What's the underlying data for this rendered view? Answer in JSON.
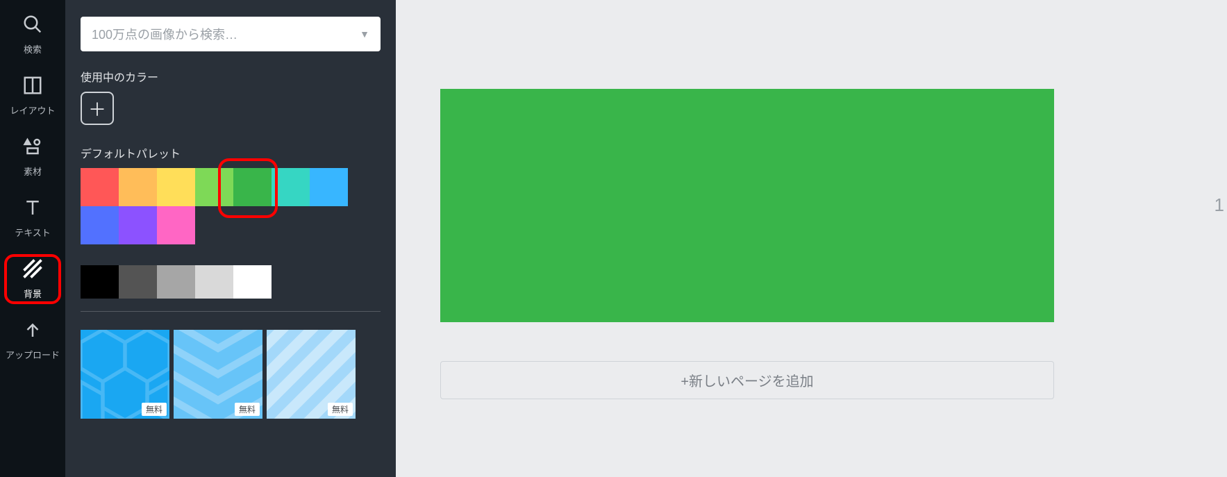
{
  "nav": {
    "items": [
      {
        "key": "search",
        "label": "検索",
        "icon": "search-icon"
      },
      {
        "key": "layout",
        "label": "レイアウト",
        "icon": "layout-icon"
      },
      {
        "key": "elements",
        "label": "素材",
        "icon": "shapes-icon"
      },
      {
        "key": "text",
        "label": "テキスト",
        "icon": "text-icon"
      },
      {
        "key": "background",
        "label": "背景",
        "icon": "stripes-icon",
        "selected": true
      },
      {
        "key": "upload",
        "label": "アップロード",
        "icon": "upload-icon"
      }
    ]
  },
  "panel": {
    "search_placeholder": "100万点の画像から検索…",
    "sections": {
      "colors_in_use_title": "使用中のカラー",
      "default_palette_title": "デフォルトパレット"
    },
    "default_palette": {
      "row1": [
        "#ff5757",
        "#ffbd59",
        "#ffde59",
        "#7ed957",
        "#39b54a",
        "#36d6c3",
        "#38b6ff"
      ],
      "row2": [
        "#5271ff",
        "#8c52ff",
        "#ff66c4"
      ],
      "highlight_index": 4
    },
    "grayscale_row": [
      "#000000",
      "#545454",
      "#a6a6a6",
      "#d9d9d9",
      "#ffffff"
    ],
    "background_patterns": [
      {
        "name": "hexagon-pattern",
        "free_label": "無料",
        "base_color": "#1aa7f2",
        "accent_color": "#2db4f6"
      },
      {
        "name": "chevron-pattern",
        "free_label": "無料",
        "base_color": "#67c4f8",
        "accent_color": "#86d0f9"
      },
      {
        "name": "diagonal-pattern",
        "free_label": "無料",
        "base_color": "#a3d8fa",
        "accent_color": "#c4e6fb"
      }
    ]
  },
  "canvas": {
    "page_color": "#39b54a",
    "add_page_label": "+新しいページを追加",
    "current_page_indicator": "1"
  }
}
